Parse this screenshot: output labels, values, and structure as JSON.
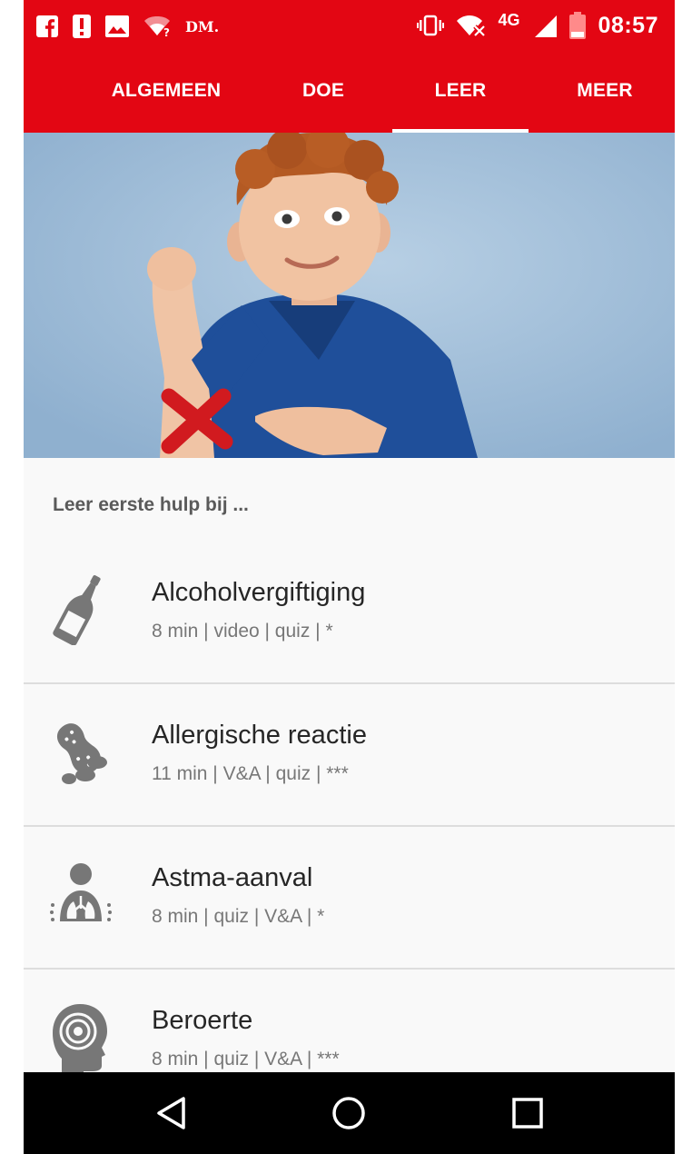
{
  "status_bar": {
    "carrier_label": "DM.",
    "network": "4G",
    "time": "08:57",
    "icons": [
      "facebook-icon",
      "alert-icon",
      "image-icon",
      "wifi-question-icon",
      "vibrate-icon",
      "wifi-off-icon",
      "signal-icon",
      "battery-icon"
    ]
  },
  "tabs": [
    {
      "label": "ALGEMEEN",
      "active": false
    },
    {
      "label": "DOE",
      "active": false
    },
    {
      "label": "LEER",
      "active": true
    },
    {
      "label": "MEER",
      "active": false
    }
  ],
  "hero": {
    "icon": "hero-photo"
  },
  "section": {
    "heading": "Leer eerste hulp bij ..."
  },
  "list": [
    {
      "title": "Alcoholvergiftiging",
      "meta": "8 min | video | quiz | *",
      "icon": "bottle-icon"
    },
    {
      "title": "Allergische reactie",
      "meta": "11 min | V&A | quiz | ***",
      "icon": "peanut-icon"
    },
    {
      "title": "Astma-aanval",
      "meta": "8 min | quiz | V&A | *",
      "icon": "lungs-icon"
    },
    {
      "title": "Beroerte",
      "meta": "8 min | quiz | V&A | ***",
      "icon": "head-icon"
    }
  ],
  "nav": {
    "icons": [
      "back-icon",
      "home-icon",
      "recents-icon"
    ]
  },
  "colors": {
    "brand_red": "#e30613",
    "text_dark": "#262626",
    "text_muted": "#777777",
    "icon_grey": "#777777"
  }
}
